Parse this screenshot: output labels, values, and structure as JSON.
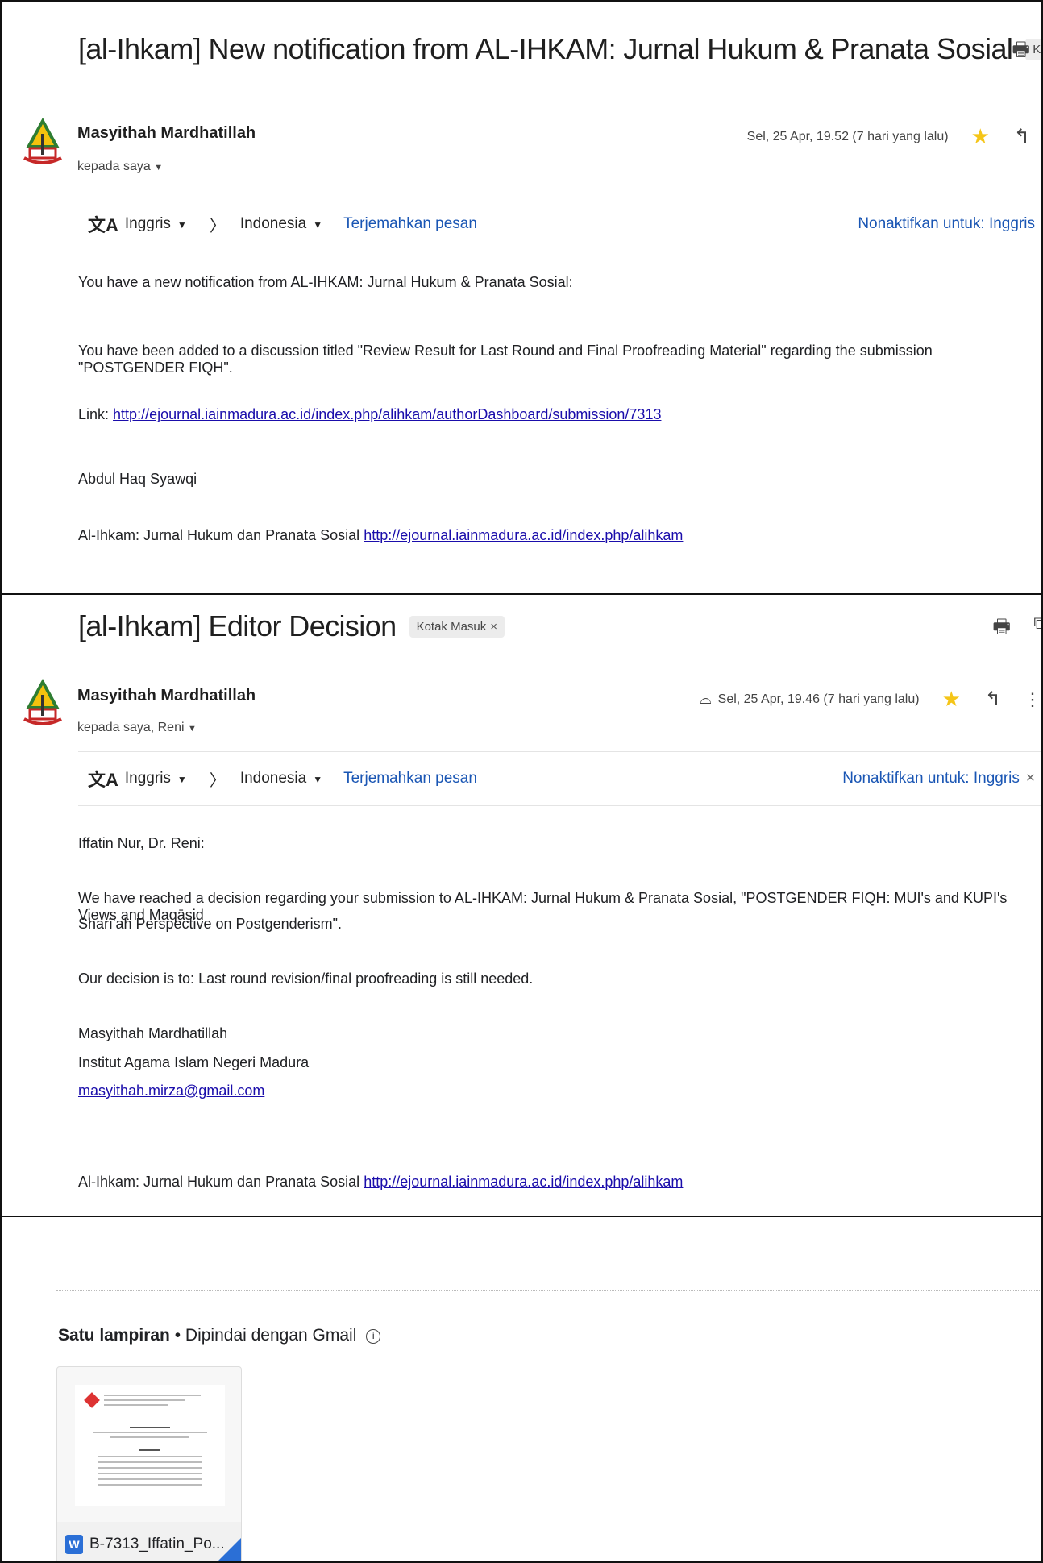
{
  "email1": {
    "subject": "[al-Ihkam] New notification from AL-IHKAM: Jurnal Hukum & Pranata Sosial",
    "label": "Kotak Masuk",
    "sender": "Masyithah Mardhatillah",
    "recipient": "kepada saya",
    "date": "Sel, 25 Apr, 19.52 (7 hari yang lalu)",
    "translate": {
      "from": "Inggris",
      "to": "Indonesia",
      "action": "Terjemahkan pesan",
      "disable": "Nonaktifkan untuk: Inggris"
    },
    "line1": "You have a new notification from AL-IHKAM: Jurnal Hukum & Pranata Sosial:",
    "line2": "You have been added to a discussion titled \"Review Result for Last Round and Final Proofreading Material\" regarding the submission \"POSTGENDER FIQH\".",
    "link_label": "Link:",
    "link_url": "http://ejournal.iainmadura.ac.id/index.php/alihkam/authorDashboard/submission/7313",
    "signature": "Abdul Haq Syawqi",
    "footer_text": "Al-Ihkam: Jurnal Hukum dan Pranata Sosial",
    "footer_url": "http://ejournal.iainmadura.ac.id/index.php/alihkam"
  },
  "email2": {
    "subject": "[al-Ihkam] Editor Decision",
    "label": "Kotak Masuk",
    "sender": "Masyithah Mardhatillah",
    "recipient": "kepada saya, Reni",
    "date": "Sel, 25 Apr, 19.46 (7 hari yang lalu)",
    "translate": {
      "from": "Inggris",
      "to": "Indonesia",
      "action": "Terjemahkan pesan",
      "disable": "Nonaktifkan untuk: Inggris"
    },
    "greeting": "Iffatin Nur, Dr. Reni:",
    "para1a": "We have reached a decision regarding your submission to AL-IHKAM: Jurnal Hukum & Pranata Sosial, \"POSTGENDER FIQH: MUI's and KUPI's Views and Maqāṣid",
    "para1b": "Sharī'ah Perspective on Postgenderism\".",
    "decision": "Our decision is to: Last round revision/final proofreading is still needed.",
    "sig_name": "Masyithah Mardhatillah",
    "sig_inst": "Institut Agama Islam Negeri Madura",
    "sig_email": "masyithah.mirza@gmail.com",
    "footer_text": "Al-Ihkam: Jurnal Hukum dan Pranata Sosial",
    "footer_url": "http://ejournal.iainmadura.ac.id/index.php/alihkam"
  },
  "attachments": {
    "count_label": "Satu lampiran",
    "scanned": "Dipindai dengan Gmail",
    "file_name": "B-7313_Iffatin_Po...",
    "file_type": "W"
  },
  "icons": {
    "print": "print-icon",
    "reply": "reply-icon",
    "star": "star-icon",
    "translate": "translate-icon"
  },
  "colors": {
    "link": "#1a56b4",
    "star": "#f5c518",
    "word": "#2b6fd6"
  }
}
